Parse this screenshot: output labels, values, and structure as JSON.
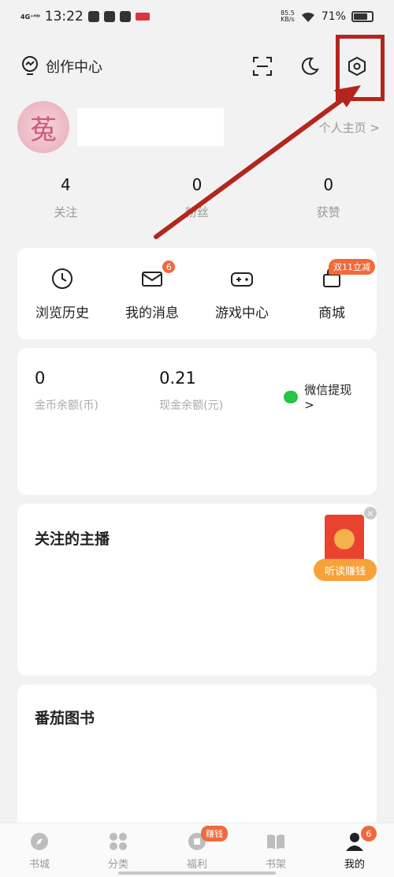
{
  "status_bar": {
    "network": "4G⁺ᴴᴰ",
    "time": "13:22",
    "speed_value": "85.5",
    "speed_unit": "KB/s",
    "battery": "71%"
  },
  "topbar": {
    "creator_label": "创作中心"
  },
  "profile": {
    "avatar_char": "菟",
    "homepage_link": "个人主页 >"
  },
  "stats": [
    {
      "value": "4",
      "label": "关注"
    },
    {
      "value": "0",
      "label": "粉丝"
    },
    {
      "value": "0",
      "label": "获赞"
    }
  ],
  "quick_actions": [
    {
      "label": "浏览历史",
      "icon": "clock-icon"
    },
    {
      "label": "我的消息",
      "icon": "mail-icon",
      "badge": "6"
    },
    {
      "label": "游戏中心",
      "icon": "gamepad-icon"
    },
    {
      "label": "商城",
      "icon": "bag-icon",
      "tag": "双11立减"
    }
  ],
  "wallet": {
    "coins_value": "0",
    "coins_label": "金币余额(币)",
    "cash_value": "0.21",
    "cash_label": "现金余额(元)",
    "withdraw_label": "微信提现 >"
  },
  "follow": {
    "title": "关注的主播",
    "redpacket_label": "听读赚钱"
  },
  "books": {
    "title": "番茄图书"
  },
  "tabs": [
    {
      "label": "书城",
      "icon": "compass-icon"
    },
    {
      "label": "分类",
      "icon": "grid-icon"
    },
    {
      "label": "福利",
      "icon": "gift-icon",
      "tag": "赚钱"
    },
    {
      "label": "书架",
      "icon": "book-icon"
    },
    {
      "label": "我的",
      "icon": "user-icon",
      "badge": "6",
      "active": true
    }
  ],
  "colors": {
    "accent": "#f06a3c",
    "highlight": "#b3261e",
    "wechat": "#28c445"
  }
}
